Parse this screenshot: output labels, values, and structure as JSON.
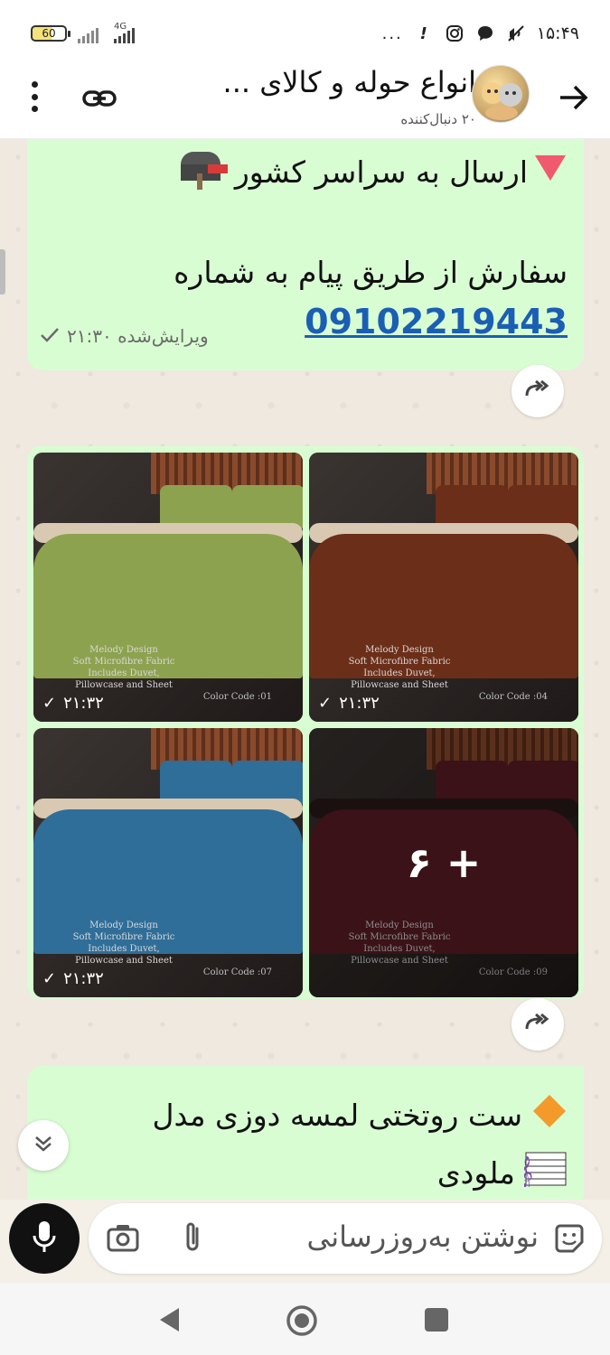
{
  "status_bar": {
    "battery": "60",
    "network": "4G",
    "time": "۱۵:۴۹",
    "more": "..."
  },
  "header": {
    "title": "انواع حوله و کالای ...",
    "subtitle": "۲۰ دنبال‌کننده"
  },
  "messages": {
    "m1": {
      "line1": "ارسال به سراسر کشور",
      "line2": "سفارش از طریق پیام به شماره",
      "phone": "09102219443",
      "edited_label": "ویرایش‌شده ۲۱:۳۰"
    },
    "album": {
      "photos": [
        {
          "time": "۲۱:۳۲",
          "caption": "Melody Design\nSoft Microfibre Fabric\nIncludes Duvet,\nPillowcase and Sheet",
          "code": "Color Code :01",
          "color": "#8da24e"
        },
        {
          "time": "۲۱:۳۲",
          "caption": "Melody Design\nSoft Microfibre Fabric\nIncludes Duvet,\nPillowcase and Sheet",
          "code": "Color Code :04",
          "color": "#6b2e18"
        },
        {
          "time": "۲۱:۳۲",
          "caption": "Melody Design\nSoft Microfibre Fabric\nIncludes Duvet,\nPillowcase and Sheet",
          "code": "Color Code :07",
          "color": "#2f6e98"
        },
        {
          "time": "",
          "caption": "Melody Design\nSoft Microfibre Fabric\nIncludes Duvet,\nPillowcase and Sheet",
          "code": "Color Code :09",
          "color": "#5a1d24"
        }
      ],
      "more_count": "+ ۶"
    },
    "m2": {
      "line1": "ست روتختی لمسه  دوزی مدل",
      "line2": "ملودی"
    }
  },
  "composer": {
    "placeholder": "نوشتن به‌روزرسانی"
  },
  "colors": {
    "bubble": "#d9fdd3",
    "link": "#1a5fb4",
    "mic": "#111111"
  }
}
